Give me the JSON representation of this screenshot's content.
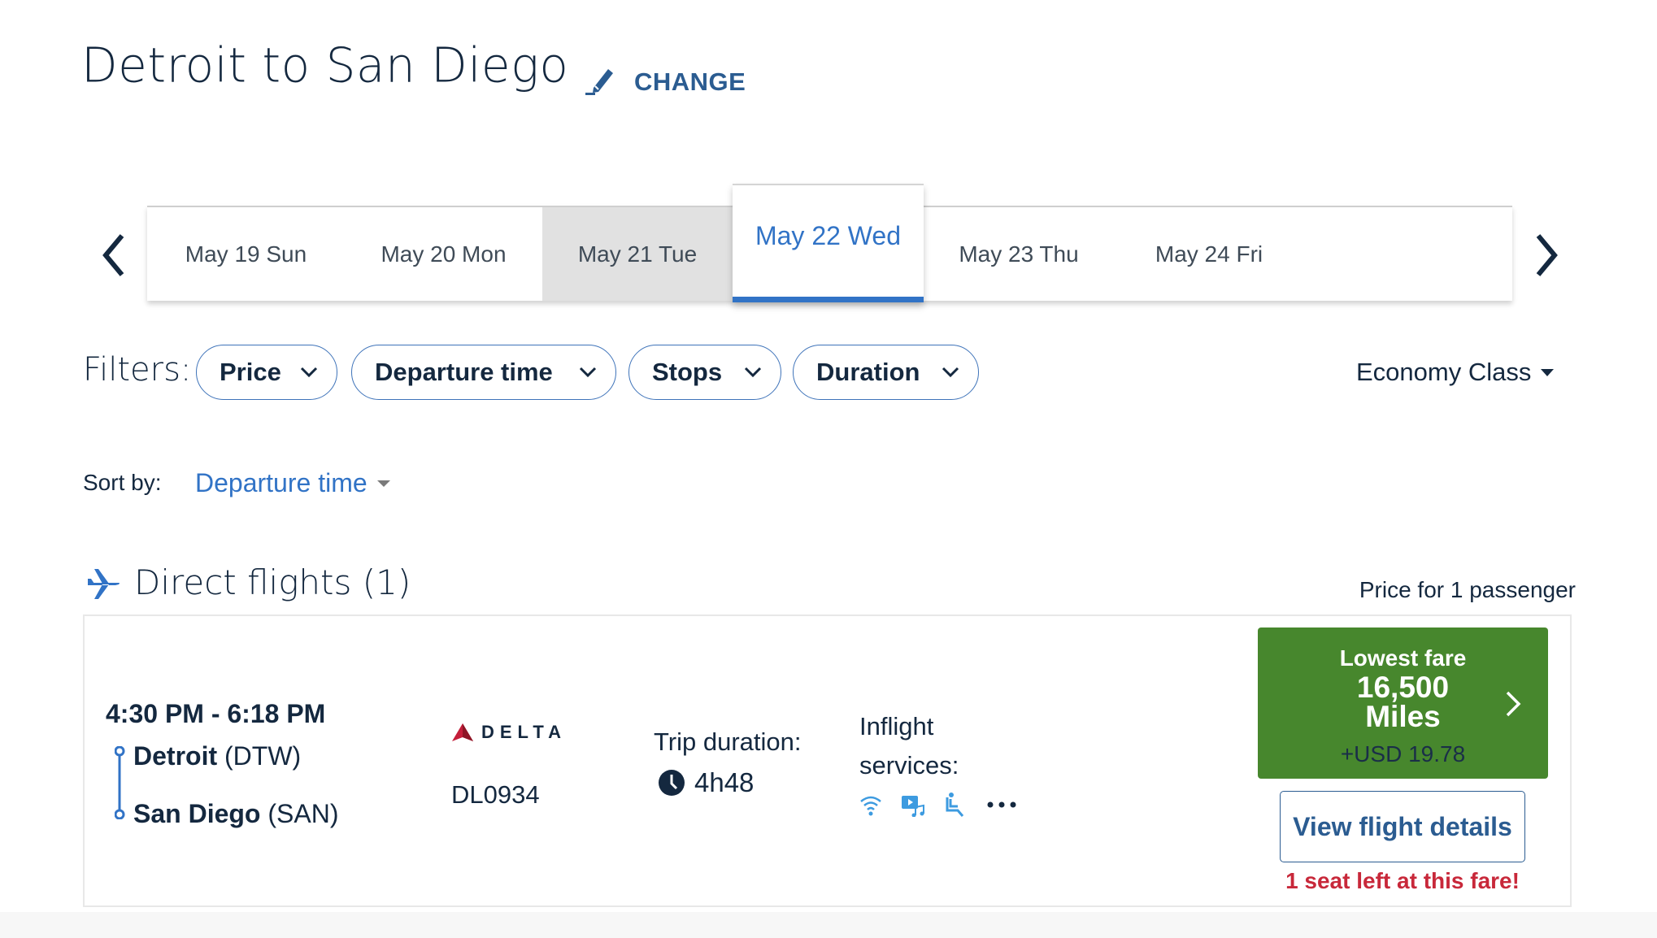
{
  "header": {
    "title": "Detroit to San Diego",
    "change_label": "CHANGE"
  },
  "date_strip": {
    "prev_icon": "chevron-left-icon",
    "next_icon": "chevron-right-icon",
    "dates": [
      {
        "label": "May 19 Sun",
        "state": "normal"
      },
      {
        "label": "May 20 Mon",
        "state": "normal"
      },
      {
        "label": "May 21 Tue",
        "state": "gray"
      },
      {
        "label": "May 22 Wed",
        "state": "selected"
      },
      {
        "label": "May 23 Thu",
        "state": "normal"
      },
      {
        "label": "May 24 Fri",
        "state": "normal"
      }
    ]
  },
  "filters": {
    "label": "Filters:",
    "items": [
      {
        "label": "Price"
      },
      {
        "label": "Departure time"
      },
      {
        "label": "Stops"
      },
      {
        "label": "Duration"
      }
    ],
    "cabin": "Economy Class"
  },
  "sort": {
    "label": "Sort by:",
    "value": "Departure time"
  },
  "section": {
    "title": "Direct flights (1)",
    "price_note": "Price for 1 passenger"
  },
  "flight": {
    "times": "4:30 PM - 6:18 PM",
    "origin_city": "Detroit",
    "origin_code": "(DTW)",
    "dest_city": "San Diego",
    "dest_code": "(SAN)",
    "airline": "DELTA",
    "flight_number": "DL0934",
    "trip_duration_label": "Trip duration:",
    "trip_duration": "4h48",
    "inflight_label": "Inflight services:",
    "services": [
      "wifi-icon",
      "entertainment-icon",
      "seat-icon",
      "more-icon"
    ],
    "fare": {
      "label": "Lowest fare",
      "miles": "16,500",
      "miles_unit": "Miles",
      "cash": "+USD 19.78"
    },
    "details_label": "View flight details",
    "seat_warning": "1 seat left at this fare!"
  },
  "colors": {
    "primary_text": "#14283f",
    "link_blue": "#3173c6",
    "button_blue": "#2b5c91",
    "fare_green": "#47872d",
    "warning_red": "#c8283a"
  }
}
